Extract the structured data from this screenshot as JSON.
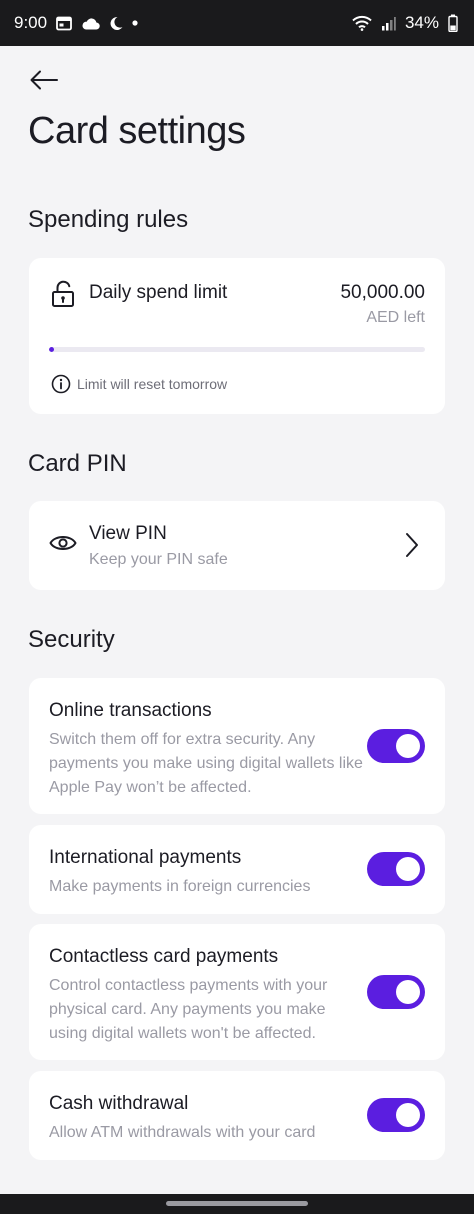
{
  "status_bar": {
    "time": "9:00",
    "battery": "34%",
    "icons_left": [
      "calendar-icon",
      "cloud-icon",
      "moon-icon",
      "dot-icon"
    ],
    "icons_right": [
      "wifi-icon",
      "signal-icon",
      "battery-icon"
    ]
  },
  "header": {
    "back_icon": "arrow-left-icon",
    "title": "Card settings"
  },
  "spending_rules": {
    "section_title": "Spending rules",
    "limit_label": "Daily spend limit",
    "limit_value": "50,000.00",
    "limit_sub": "AED left",
    "progress_fraction": 0.01,
    "info_text": "Limit will reset tomorrow",
    "accent_color": "#5b1ee0"
  },
  "card_pin": {
    "section_title": "Card PIN",
    "title": "View PIN",
    "subtitle": "Keep your PIN safe"
  },
  "security": {
    "section_title": "Security",
    "items": [
      {
        "title": "Online transactions",
        "description": "Switch them off for extra security. Any payments you make using digital wallets like Apple Pay won’t be affected.",
        "enabled": true
      },
      {
        "title": "International payments",
        "description": "Make payments in foreign currencies",
        "enabled": true
      },
      {
        "title": "Contactless card payments",
        "description": "Control contactless payments with your physical card. Any payments you make using digital wallets won't be affected.",
        "enabled": true
      },
      {
        "title": "Cash withdrawal",
        "description": "Allow ATM withdrawals with your card",
        "enabled": true
      }
    ]
  }
}
